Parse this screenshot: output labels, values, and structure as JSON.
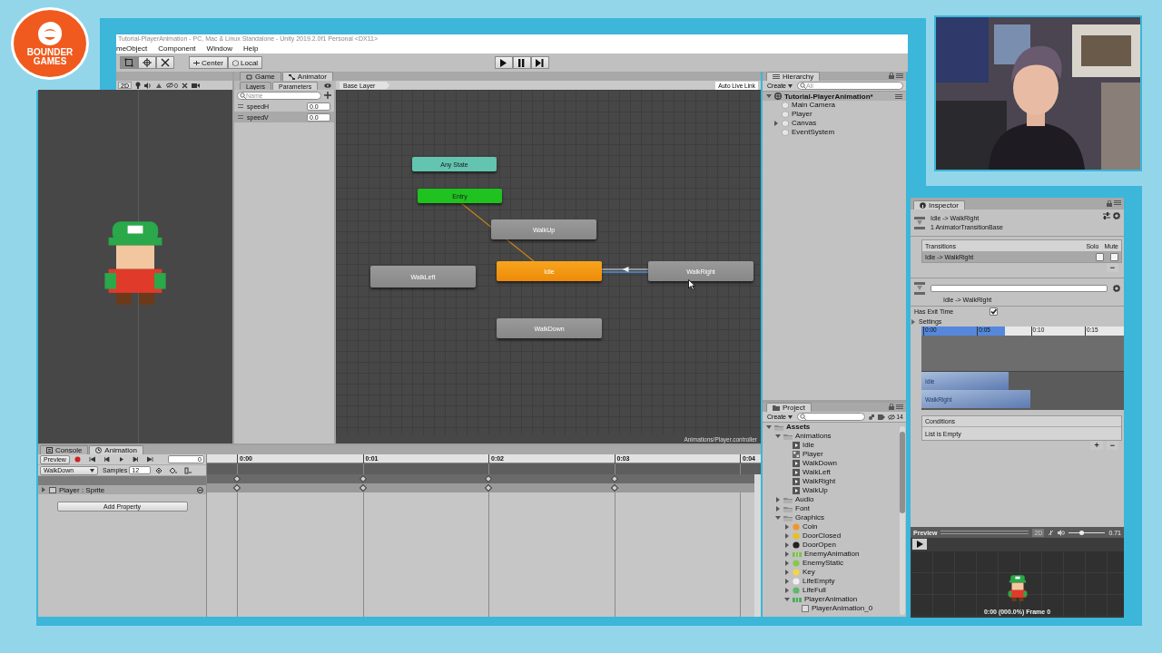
{
  "logo": {
    "text": "BOUNDER GAMES"
  },
  "webcam": {
    "kind": "picture"
  },
  "window": {
    "title": "Tutorial-PlayerAnimation - PC, Mac & Linux Standalone - Unity 2019.2.0f1 Personal <DX11>"
  },
  "menu": [
    "meObject",
    "Component",
    "Window",
    "Help"
  ],
  "toolbar": {
    "tools": [
      {
        "kind": "rect",
        "selected": true
      },
      {
        "kind": "transform",
        "selected": false
      },
      {
        "kind": "custom",
        "selected": false
      }
    ],
    "pivot": "Center",
    "space": "Local",
    "playback": [
      {
        "kind": "play"
      },
      {
        "kind": "pause"
      },
      {
        "kind": "step"
      }
    ]
  },
  "game_view": {
    "mode": "2D",
    "gizmo_count": "0"
  },
  "animator": {
    "tabs": [
      {
        "label": "Game",
        "selected": false
      },
      {
        "label": "Animator",
        "selected": true
      }
    ],
    "side_tabs": [
      {
        "label": "Layers",
        "selected": false
      },
      {
        "label": "Parameters",
        "selected": true
      }
    ],
    "search": {
      "placeholder": "Name"
    },
    "parameters": [
      {
        "name": "speedH",
        "value": "0.0",
        "selected": false
      },
      {
        "name": "speedV",
        "value": "0.0",
        "selected": true
      }
    ],
    "breadcrumb": "Base Layer",
    "live_link": "Auto Live Link",
    "states": [
      {
        "name": "Any State",
        "kind": "any"
      },
      {
        "name": "Entry",
        "kind": "entry"
      },
      {
        "name": "WalkUp",
        "kind": "normal"
      },
      {
        "name": "WalkLeft",
        "kind": "normal"
      },
      {
        "name": "Idle",
        "kind": "default"
      },
      {
        "name": "WalkRight",
        "kind": "normal"
      },
      {
        "name": "WalkDown",
        "kind": "normal"
      }
    ],
    "transitions": [
      {
        "kind": "entry",
        "selected": false
      },
      {
        "kind": "state",
        "selected": true
      }
    ],
    "path": "Animations/Player.controller"
  },
  "hierarchy": {
    "tab": "Hierarchy",
    "create": "Create",
    "search": {
      "placeholder": "All"
    },
    "scene": "Tutorial-PlayerAnimation*",
    "expanded": true,
    "items": [
      {
        "name": "Main Camera"
      },
      {
        "name": "Player"
      },
      {
        "name": "Canvas",
        "expanded": false
      },
      {
        "name": "EventSystem"
      }
    ]
  },
  "project": {
    "tab": "Project",
    "create": "Create",
    "count": "14",
    "tree": [
      {
        "name": "Assets",
        "kind": "folder",
        "expanded": true,
        "children": [
          {
            "name": "Animations",
            "kind": "folder",
            "expanded": true,
            "children": [
              {
                "name": "Idle",
                "kind": "clip"
              },
              {
                "name": "Player",
                "kind": "controller"
              },
              {
                "name": "WalkDown",
                "kind": "clip"
              },
              {
                "name": "WalkLeft",
                "kind": "clip"
              },
              {
                "name": "WalkRight",
                "kind": "clip"
              },
              {
                "name": "WalkUp",
                "kind": "clip"
              }
            ]
          },
          {
            "name": "Audio",
            "kind": "folder",
            "expanded": false
          },
          {
            "name": "Font",
            "kind": "folder",
            "expanded": false
          },
          {
            "name": "Graphics",
            "kind": "folder",
            "expanded": true,
            "children": [
              {
                "name": "Coin",
                "kind": "sprite",
                "color": "#f0962a",
                "expanded": false
              },
              {
                "name": "DoorClosed",
                "kind": "sprite",
                "color": "#e8c020",
                "expanded": false
              },
              {
                "name": "DoorOpen",
                "kind": "sprite",
                "color": "#222222",
                "expanded": false
              },
              {
                "name": "EnemyAnimation",
                "kind": "sheet",
                "color": "#7cc04a",
                "expanded": false
              },
              {
                "name": "EnemyStatic",
                "kind": "sprite",
                "color": "#86c84e",
                "expanded": false
              },
              {
                "name": "Key",
                "kind": "sprite",
                "color": "#f2d54a",
                "expanded": false
              },
              {
                "name": "LifeEmpty",
                "kind": "sprite",
                "color": "#eeeeee",
                "expanded": false
              },
              {
                "name": "LifeFull",
                "kind": "sprite",
                "color": "#5fb86a",
                "expanded": false
              },
              {
                "name": "PlayerAnimation",
                "kind": "sheet",
                "color": "#4fa85a",
                "expanded": true,
                "children": [
                  {
                    "name": "PlayerAnimation_0",
                    "kind": "frame"
                  }
                ]
              }
            ]
          }
        ]
      }
    ]
  },
  "animation": {
    "tabs": [
      {
        "label": "Console",
        "selected": false
      },
      {
        "label": "Animation",
        "selected": true
      }
    ],
    "preview": "Preview",
    "frame": "0",
    "clip": "WalkDown",
    "samples_label": "Samples",
    "samples": "12",
    "property": "Player : Sprite",
    "add_property": "Add Property",
    "ticks": [
      {
        "label": "0:00",
        "keyframe": true
      },
      {
        "label": "0:01",
        "keyframe": true
      },
      {
        "label": "0:02",
        "keyframe": true
      },
      {
        "label": "0:03",
        "keyframe": true
      },
      {
        "label": "0:04",
        "keyframe": false
      }
    ]
  },
  "inspector": {
    "tab": "Inspector",
    "title": "Idle -> WalkRight",
    "subtitle": "1 AnimatorTransitionBase",
    "transitions_header": "Transitions",
    "solo": "Solo",
    "mute": "Mute",
    "transitions": [
      {
        "name": "Idle -> WalkRight",
        "solo": false,
        "mute": false,
        "selected": true
      }
    ],
    "remove": "−",
    "transition_name": "Idle -> WalkRight",
    "has_exit_time": {
      "label": "Has Exit Time",
      "checked": true
    },
    "settings": {
      "label": "Settings",
      "expanded": false
    },
    "timeline": {
      "ticks": [
        "0:00",
        "0:05",
        "0:10",
        "0:15"
      ],
      "bars": [
        "Idle",
        "WalkRight"
      ]
    },
    "conditions": {
      "header": "Conditions",
      "empty": "List is Empty",
      "add": "+",
      "remove": "−"
    }
  },
  "preview": {
    "label": "Preview",
    "mode": "2D",
    "level": 0.35,
    "speed": "0.71",
    "status": "0:00 (000.0%) Frame 0"
  }
}
